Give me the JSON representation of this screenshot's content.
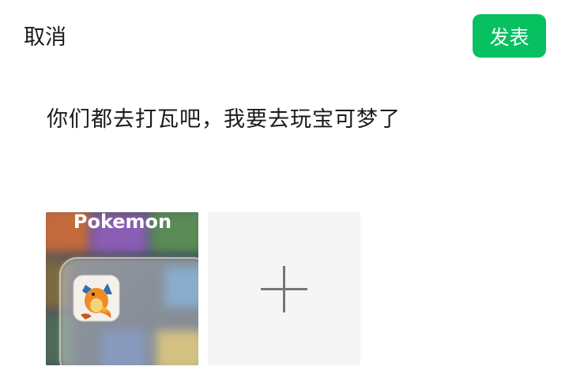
{
  "header": {
    "cancel_label": "取消",
    "publish_label": "发表",
    "accent_color": "#07c160"
  },
  "post": {
    "text": "你们都去打瓦吧，我要去玩宝可梦了"
  },
  "media": {
    "items": [
      {
        "caption": "Pokemon",
        "icon": "charizard-app-icon"
      }
    ],
    "add_icon": "plus-icon"
  }
}
